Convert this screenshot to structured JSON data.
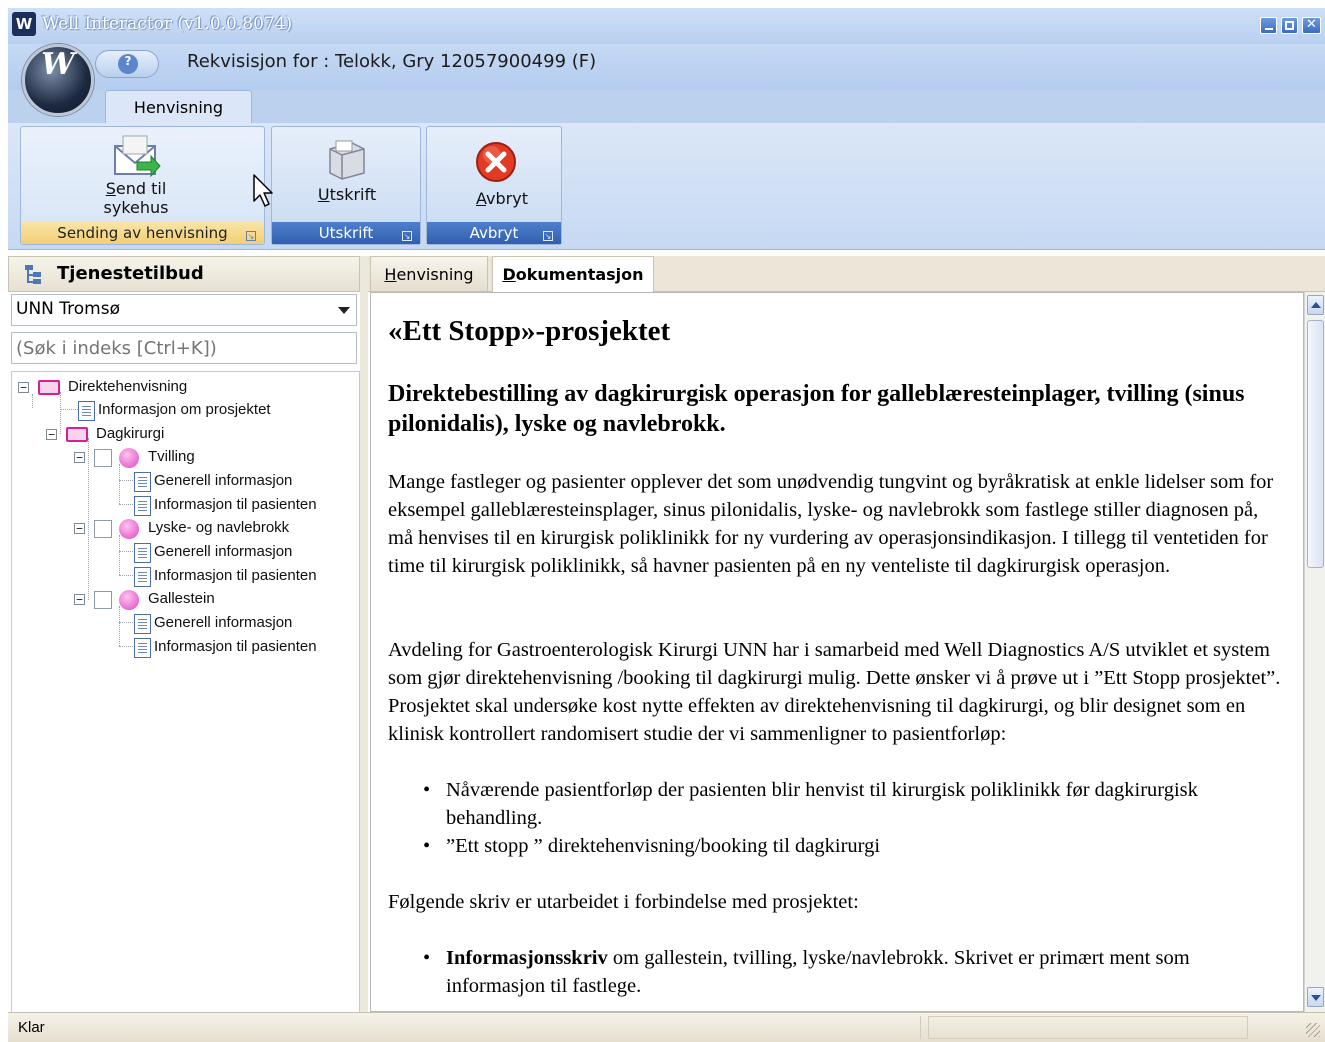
{
  "window": {
    "title": "Well Interactor (v1.0.0.8074)",
    "logo": "W"
  },
  "header": {
    "requisition": "Rekvisisjon for : Telokk, Gry 12057900499 (F)"
  },
  "ribbon": {
    "tab": "Henvisning",
    "groups": [
      {
        "button": {
          "accel": "S",
          "rest": "end til",
          "line2": "sykehus",
          "icon": "envelope-send-icon"
        },
        "footer": "Sending av henvisning"
      },
      {
        "button": {
          "accel": "U",
          "rest": "tskrift",
          "icon": "printer-icon"
        },
        "footer": "Utskrift"
      },
      {
        "button": {
          "accel": "A",
          "rest": "vbryt",
          "icon": "cancel-icon"
        },
        "footer": "Avbryt"
      }
    ]
  },
  "left": {
    "title": "Tjenestetilbud",
    "combo_value": "UNN Tromsø",
    "search_placeholder": "(Søk i indeks [Ctrl+K])",
    "tree": {
      "root": "Direktehenvisning",
      "info": "Informasjon om prosjektet",
      "group": "Dagkirurgi",
      "items": [
        {
          "label": "Tvilling",
          "children": [
            "Generell informasjon",
            "Informasjon til pasienten"
          ]
        },
        {
          "label": "Lyske- og navlebrokk",
          "children": [
            "Generell informasjon",
            "Informasjon til pasienten"
          ]
        },
        {
          "label": "Gallestein",
          "children": [
            "Generell informasjon",
            "Informasjon til pasienten"
          ]
        }
      ]
    }
  },
  "doc": {
    "tabs": [
      {
        "accel": "H",
        "rest": "envisning"
      },
      {
        "accel": "D",
        "rest": "okumentasjon"
      }
    ],
    "active_tab": 1,
    "h1": "«Ett Stopp»-prosjektet",
    "h2": "Direktebestilling av dagkirurgisk operasjon for galleblæresteinplager, tvilling (sinus pilonidalis), lyske og navlebrokk.",
    "p1": "Mange fastleger og pasienter opplever det som unødvendig tungvint og byråkratisk at enkle lidelser som for eksempel galleblæresteinsplager, sinus pilonidalis, lyske- og navlebrokk som fastlege stiller diagnosen på, må henvises til en kirurgisk poliklinikk for ny vurdering av operasjonsindikasjon. I tillegg til ventetiden for time til kirurgisk poliklinikk, så havner pasienten på en ny venteliste til dagkirurgisk operasjon.",
    "p2": "Avdeling for Gastroenterologisk Kirurgi UNN har i samarbeid med Well Diagnostics A/S utviklet et system som gjør direktehenvisning /booking til dagkirurgi mulig. Dette ønsker vi å prøve ut i ”Ett Stopp prosjektet”. Prosjektet skal undersøke kost nytte effekten av direktehenvisning til dagkirurgi, og blir designet som en klinisk kontrollert randomisert studie der vi sammenligner to pasientforløp:",
    "bullets1": [
      "Nåværende pasientforløp der pasienten blir henvist til kirurgisk poliklinikk før dagkirurgisk behandling.",
      "”Ett stopp ” direktehenvisning/booking til dagkirurgi"
    ],
    "p3": "Følgende skriv er utarbeidet i forbindelse med prosjektet:",
    "bullet2_bold": "Informasjonsskriv",
    "bullet2_rest": " om gallestein, tvilling, lyske/navlebrokk. Skrivet er primært ment som informasjon til fastlege."
  },
  "status": {
    "text": "Klar"
  }
}
